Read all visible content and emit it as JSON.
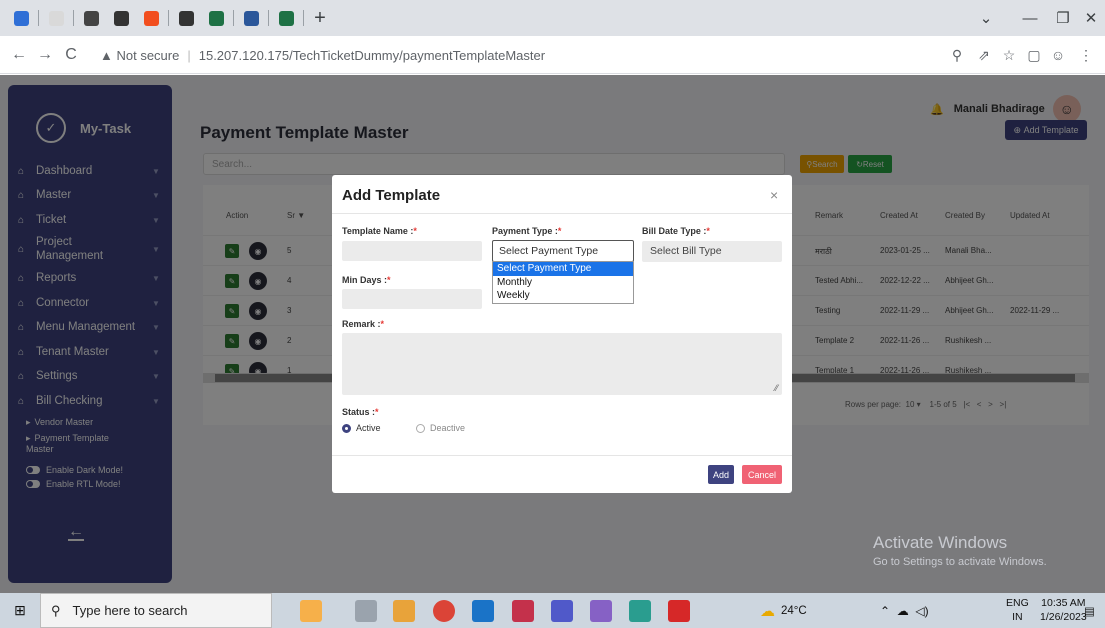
{
  "browser": {
    "tab_icon_colors": [
      "#2f6fd6",
      "#d9d9d9",
      "#444444",
      "#333333",
      "#f24e1e",
      "#333333",
      "#1e7145",
      "#2b579a",
      "#1e7145"
    ],
    "new_tab_label": "+",
    "window_controls": [
      "⌄",
      "—",
      "❐",
      "✕"
    ],
    "nav": {
      "back": "←",
      "forward": "→",
      "reload": "C"
    },
    "security_warning": "▲ Not secure",
    "url": "15.207.120.175/TechTicketDummy/paymentTemplateMaster"
  },
  "sidebar": {
    "brand": "My-Task",
    "items": [
      {
        "label": "Dashboard"
      },
      {
        "label": "Master"
      },
      {
        "label": "Ticket"
      },
      {
        "label": "Project Management"
      },
      {
        "label": "Reports"
      },
      {
        "label": "Connector"
      },
      {
        "label": "Menu Management"
      },
      {
        "label": "Tenant Master"
      },
      {
        "label": "Settings"
      },
      {
        "label": "Bill Checking"
      }
    ],
    "subitems": [
      "Vendor Master",
      "Payment Template Master"
    ],
    "toggles": [
      "Enable Dark Mode!",
      "Enable RTL Mode!"
    ],
    "collapse_arrow": "←"
  },
  "header": {
    "page_title": "Payment Template Master",
    "user_name": "Manali Bhadirage",
    "add_template_label": "Add Template",
    "search_placeholder": "Search...",
    "search_btn": "Search",
    "reset_btn": "Reset"
  },
  "table": {
    "columns": [
      "Action",
      "Sr ▼",
      "Remark",
      "Created At",
      "Created By",
      "Updated At"
    ],
    "rows": [
      {
        "sr": "5",
        "remark": "मराठी",
        "created_at": "2023-01-25 ...",
        "created_by": "Manali Bha...",
        "updated_at": ""
      },
      {
        "sr": "4",
        "remark": "Tested Abhi...",
        "created_at": "2022-12-22 ...",
        "created_by": "Abhijeet Gh...",
        "updated_at": ""
      },
      {
        "sr": "3",
        "remark": "Testing",
        "created_at": "2022-11-29 ...",
        "created_by": "Abhijeet Gh...",
        "updated_at": "2022-11-29 ..."
      },
      {
        "sr": "2",
        "remark": "Template 2",
        "created_at": "2022-11-26 ...",
        "created_by": "Rushikesh ...",
        "updated_at": ""
      },
      {
        "sr": "1",
        "remark": "Template 1",
        "created_at": "2022-11-26 ...",
        "created_by": "Rushikesh ...",
        "updated_at": ""
      }
    ],
    "rows_per_page_label": "Rows per page:",
    "rows_per_page": "10",
    "range": "1-5 of 5"
  },
  "modal": {
    "title": "Add Template",
    "close": "×",
    "template_name_label": "Template Name :",
    "payment_type_label": "Payment Type :",
    "bill_date_type_label": "Bill Date Type :",
    "required_mark": "*",
    "payment_type_value": "Select Payment Type",
    "bill_type_value": "Select Bill Type",
    "min_days_label": "Min Days :",
    "remark_label": "Remark :",
    "status_label": "Status :",
    "status_active": "Active",
    "status_deactive": "Deactive",
    "add_btn": "Add",
    "cancel_btn": "Cancel",
    "payment_type_options": [
      "Select Payment Type",
      "Monthly",
      "Weekly"
    ],
    "selected_option_index": 0
  },
  "watermark": {
    "line1": "Activate Windows",
    "line2": "Go to Settings to activate Windows."
  },
  "taskbar": {
    "search_placeholder": "Type here to search",
    "weather": "24°C",
    "lang": "ENG",
    "region": "IN",
    "time": "10:35 AM",
    "date": "1/26/2023"
  }
}
